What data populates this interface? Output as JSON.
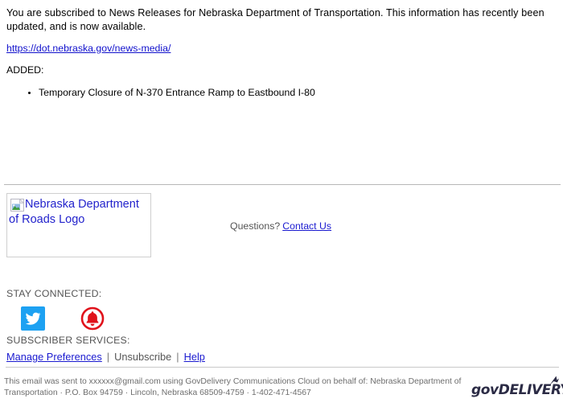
{
  "email": {
    "intro": "You are subscribed to News Releases for Nebraska Department of Transportation. This information has recently been updated, and is now available.",
    "url_text": "https://dot.nebraska.gov/news-media/",
    "added_label": "ADDED:",
    "items": [
      "Temporary Closure of N-370 Entrance Ramp to Eastbound I-80"
    ]
  },
  "branding": {
    "logo_alt": "Nebraska Department of Roads Logo",
    "logo_icon": "broken-image-icon",
    "questions_label": "Questions?",
    "contact_link": "Contact Us"
  },
  "stay_connected": {
    "label": "STAY CONNECTED:",
    "socials": [
      {
        "name": "twitter-icon",
        "color": "#1DA1F2"
      },
      {
        "name": "notification-bell-icon",
        "color": "#E0121B"
      }
    ]
  },
  "subscriber_services": {
    "label": "SUBSCRIBER SERVICES:",
    "manage_preferences": "Manage Preferences",
    "separator_1": "|",
    "unsubscribe": "Unsubscribe",
    "separator_2": "|",
    "help": "Help"
  },
  "legal": {
    "line_1": "This email was sent to xxxxxx@gmail.com using GovDelivery Communications Cloud on behalf of: Nebraska Department of",
    "line_2": "Transportation · P.O. Box 94759 · Lincoln, Nebraska 68509-4759 · 1-402-471-4567"
  },
  "govdelivery": {
    "word_gov": "gov",
    "word_delivery": "DELIVERY",
    "mark": "swoosh-arrow-icon",
    "color": "#2b2b45"
  },
  "colors": {
    "link": "#1a1ad0",
    "muted_text": "#555555",
    "rule": "#b7b7b7"
  }
}
